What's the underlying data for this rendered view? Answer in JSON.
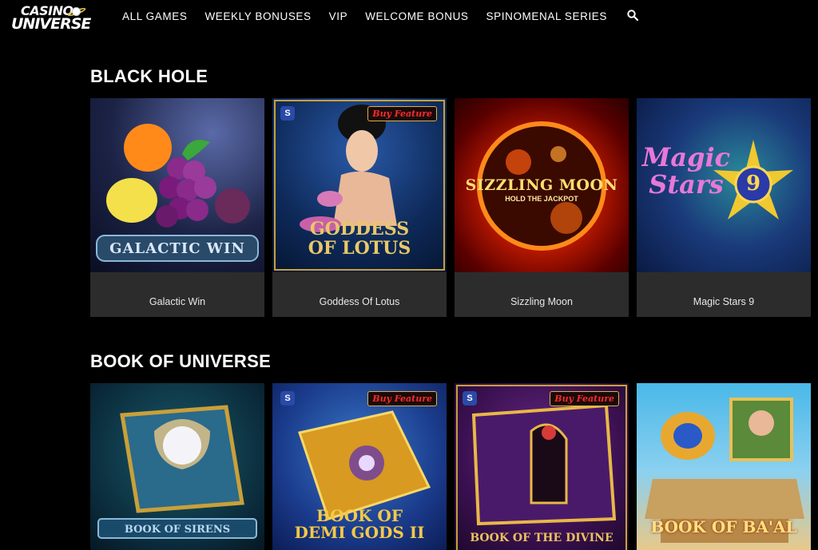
{
  "header": {
    "logo_line1": "CASINO",
    "logo_line2": "UNIVERSE",
    "nav": [
      {
        "label": "ALL GAMES"
      },
      {
        "label": "WEEKLY BONUSES"
      },
      {
        "label": "VIP"
      },
      {
        "label": "WELCOME BONUS"
      },
      {
        "label": "SPINOMENAL SERIES"
      }
    ],
    "search_icon": "search-icon"
  },
  "sections": [
    {
      "title": "BLACK HOLE",
      "games": [
        {
          "name": "Galactic Win",
          "art_text": "GALACTIC WIN"
        },
        {
          "name": "Goddess Of Lotus",
          "art_text": "GODDESS OF LOTUS",
          "badge": "Buy Feature"
        },
        {
          "name": "Sizzling Moon",
          "art_text": "SIZZLING MOON",
          "art_sub": "HOLD THE JACKPOT"
        },
        {
          "name": "Magic Stars 9",
          "art_text": "Magic Stars",
          "art_num": "9"
        }
      ]
    },
    {
      "title": "BOOK OF UNIVERSE",
      "games": [
        {
          "art_text": "BOOK OF SIRENS"
        },
        {
          "art_text": "BOOK OF DEMI GODS II",
          "badge": "Buy Feature"
        },
        {
          "art_text": "BOOK OF THE DIVINE",
          "badge": "Buy Feature"
        },
        {
          "art_text": "BOOK OF BA'AL"
        }
      ]
    }
  ],
  "provider_badge": "S",
  "colors": {
    "background": "#000000",
    "card": "#2c2c2c",
    "badge_red": "#ff2a2a",
    "gold": "#c9a03a"
  }
}
